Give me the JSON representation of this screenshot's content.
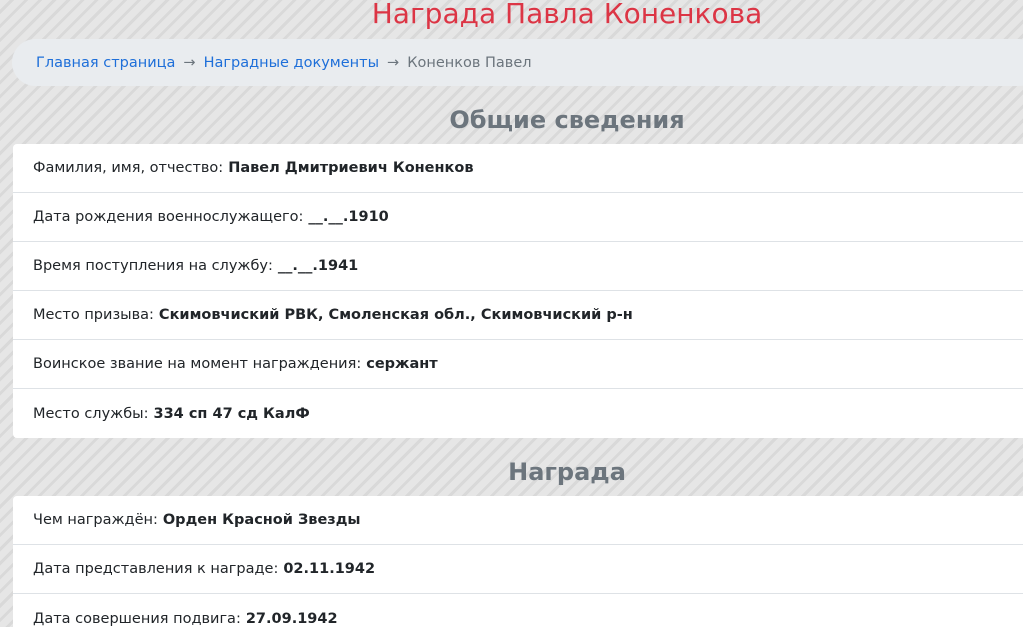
{
  "page": {
    "title": "Награда Павла Коненкова"
  },
  "breadcrumb": {
    "items": [
      {
        "label": "Главная страница"
      },
      {
        "label": "Наградные документы"
      }
    ],
    "separator": "→",
    "current": "Коненков Павел"
  },
  "general": {
    "heading": "Общие сведения",
    "rows": [
      {
        "label": "Фамилия, имя, отчество:",
        "value": "Павел Дмитриевич Коненков"
      },
      {
        "label": "Дата рождения военнослужащего:",
        "value": "__.__.1910"
      },
      {
        "label": "Время поступления на службу:",
        "value": "__.__.1941"
      },
      {
        "label": "Место призыва:",
        "value": "Скимовчиский РВК, Смоленская обл., Скимовчиский р-н"
      },
      {
        "label": "Воинское звание на момент награждения:",
        "value": "сержант"
      },
      {
        "label": "Место службы:",
        "value": "334 сп 47 сд КалФ"
      }
    ]
  },
  "award": {
    "heading": "Награда",
    "rows": [
      {
        "label": "Чем награждён:",
        "value": "Орден Красной Звезды"
      },
      {
        "label": "Дата представления к награде:",
        "value": "02.11.1942"
      },
      {
        "label": "Дата совершения подвига:",
        "value": "27.09.1942"
      }
    ]
  },
  "colors": {
    "title": "#dc3545",
    "link": "#1e6fd9",
    "muted": "#6c757d",
    "breadcrumb_bg": "#e9ecef"
  }
}
